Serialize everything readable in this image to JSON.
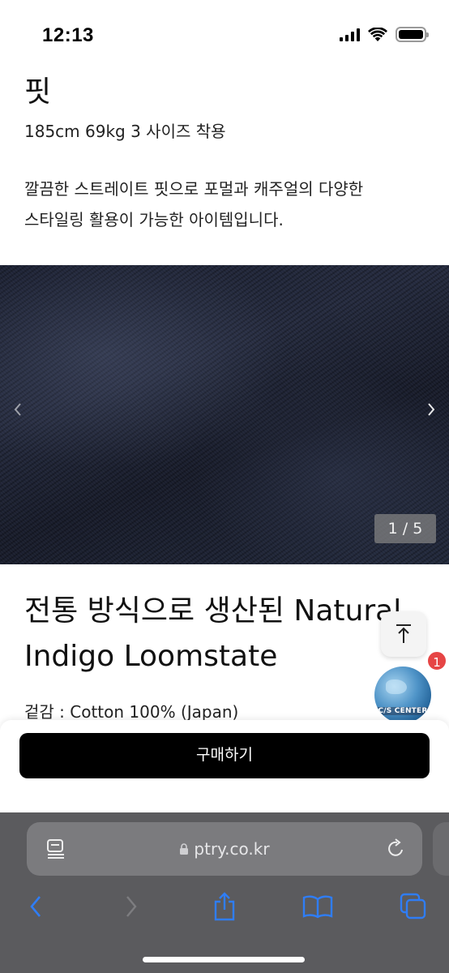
{
  "status_bar": {
    "time": "12:13"
  },
  "fit_section": {
    "title": "핏",
    "size_info": "185cm 69kg 3 사이즈 착용",
    "description_line1": "깔끔한 스트레이트 핏으로 포멀과 캐주얼의 다양한",
    "description_line2": "스타일링 활용이 가능한 아이템입니다."
  },
  "carousel": {
    "counter": "1 / 5",
    "prev_icon": "chevron-left-icon",
    "next_icon": "chevron-right-icon"
  },
  "product": {
    "headline_line1": "전통 방식으로 생산된 Natural",
    "headline_line2": "Indigo Loomstate",
    "material": "겉감 : Cotton 100% (Japan)"
  },
  "floating": {
    "scroll_top_icon": "arrow-up-to-top-icon",
    "cs_center_label": "C/S CENTER",
    "notification_count": "1"
  },
  "buy_panel": {
    "buy_label": "구매하기"
  },
  "browser": {
    "url": "ptry.co.kr",
    "accent": "#2f7df6"
  }
}
